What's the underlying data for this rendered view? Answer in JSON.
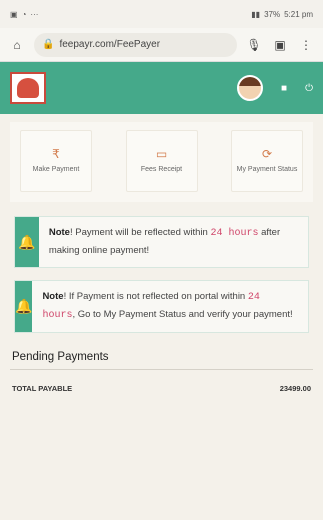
{
  "status": {
    "time": "5:21 pm",
    "battery": "37%"
  },
  "browser": {
    "url": "feepayr.com/FeePayer"
  },
  "menu": [
    {
      "icon": "rupee-icon",
      "glyph": "₹",
      "label": "Make Payment"
    },
    {
      "icon": "receipt-icon",
      "glyph": "▭",
      "label": "Fees Receipt"
    },
    {
      "icon": "status-icon",
      "glyph": "⟳",
      "label": "My Payment Status"
    }
  ],
  "notes": [
    {
      "title": "Note",
      "text1": "! Payment will be reflected within ",
      "highlight": "24 hours",
      "text2": " after making online payment!"
    },
    {
      "title": "Note",
      "text1": "! If Payment is not reflected on portal within ",
      "highlight": "24 hours",
      "text2": ", Go to My Payment Status and verify your payment!"
    }
  ],
  "pending": {
    "title": "Pending Payments",
    "total_label": "TOTAL PAYABLE",
    "total_value": "23499.00"
  },
  "colors": {
    "brand": "#45a98a",
    "highlight": "#d0466a"
  }
}
